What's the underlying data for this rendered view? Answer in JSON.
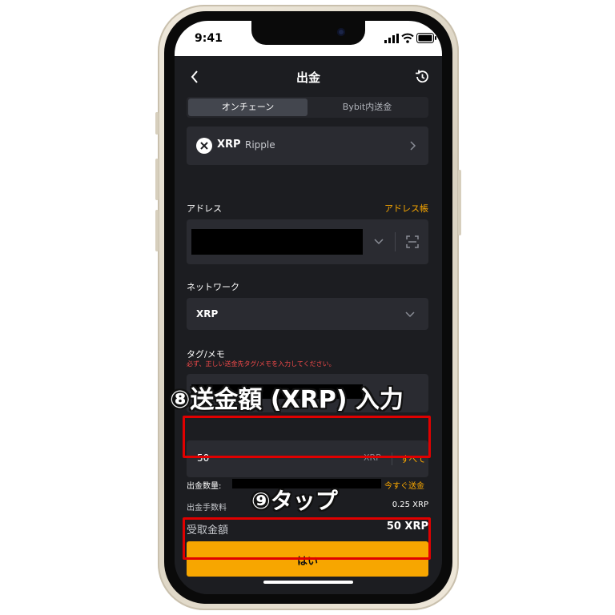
{
  "status": {
    "time": "9:41"
  },
  "header": {
    "title": "出金"
  },
  "tabs": [
    {
      "label": "オンチェーン",
      "active": true
    },
    {
      "label": "Bybit内送金",
      "active": false
    }
  ],
  "coin": {
    "symbol": "XRP",
    "name": "Ripple"
  },
  "address": {
    "label": "アドレス",
    "book_link": "アドレス帳"
  },
  "network": {
    "label": "ネットワーク",
    "value": "XRP"
  },
  "tag": {
    "label": "タグ/メモ",
    "warning": "必ず、正しい送金先タグ/メモを入力してください。"
  },
  "amount": {
    "value": "50",
    "unit": "XRP",
    "all_button": "すべて"
  },
  "withdraw": {
    "label": "出金数量:",
    "instant_link": "今すぐ送金"
  },
  "fee": {
    "label": "出金手数料",
    "value": "0.25 XRP"
  },
  "receive": {
    "label": "受取金額",
    "value": "50 XRP"
  },
  "confirm_button": "はい",
  "annotations": {
    "step8": "⑧送金額 (XRP) 入力",
    "step9": "⑨タップ"
  },
  "colors": {
    "accent": "#f7a600",
    "highlight": "#e00000"
  }
}
